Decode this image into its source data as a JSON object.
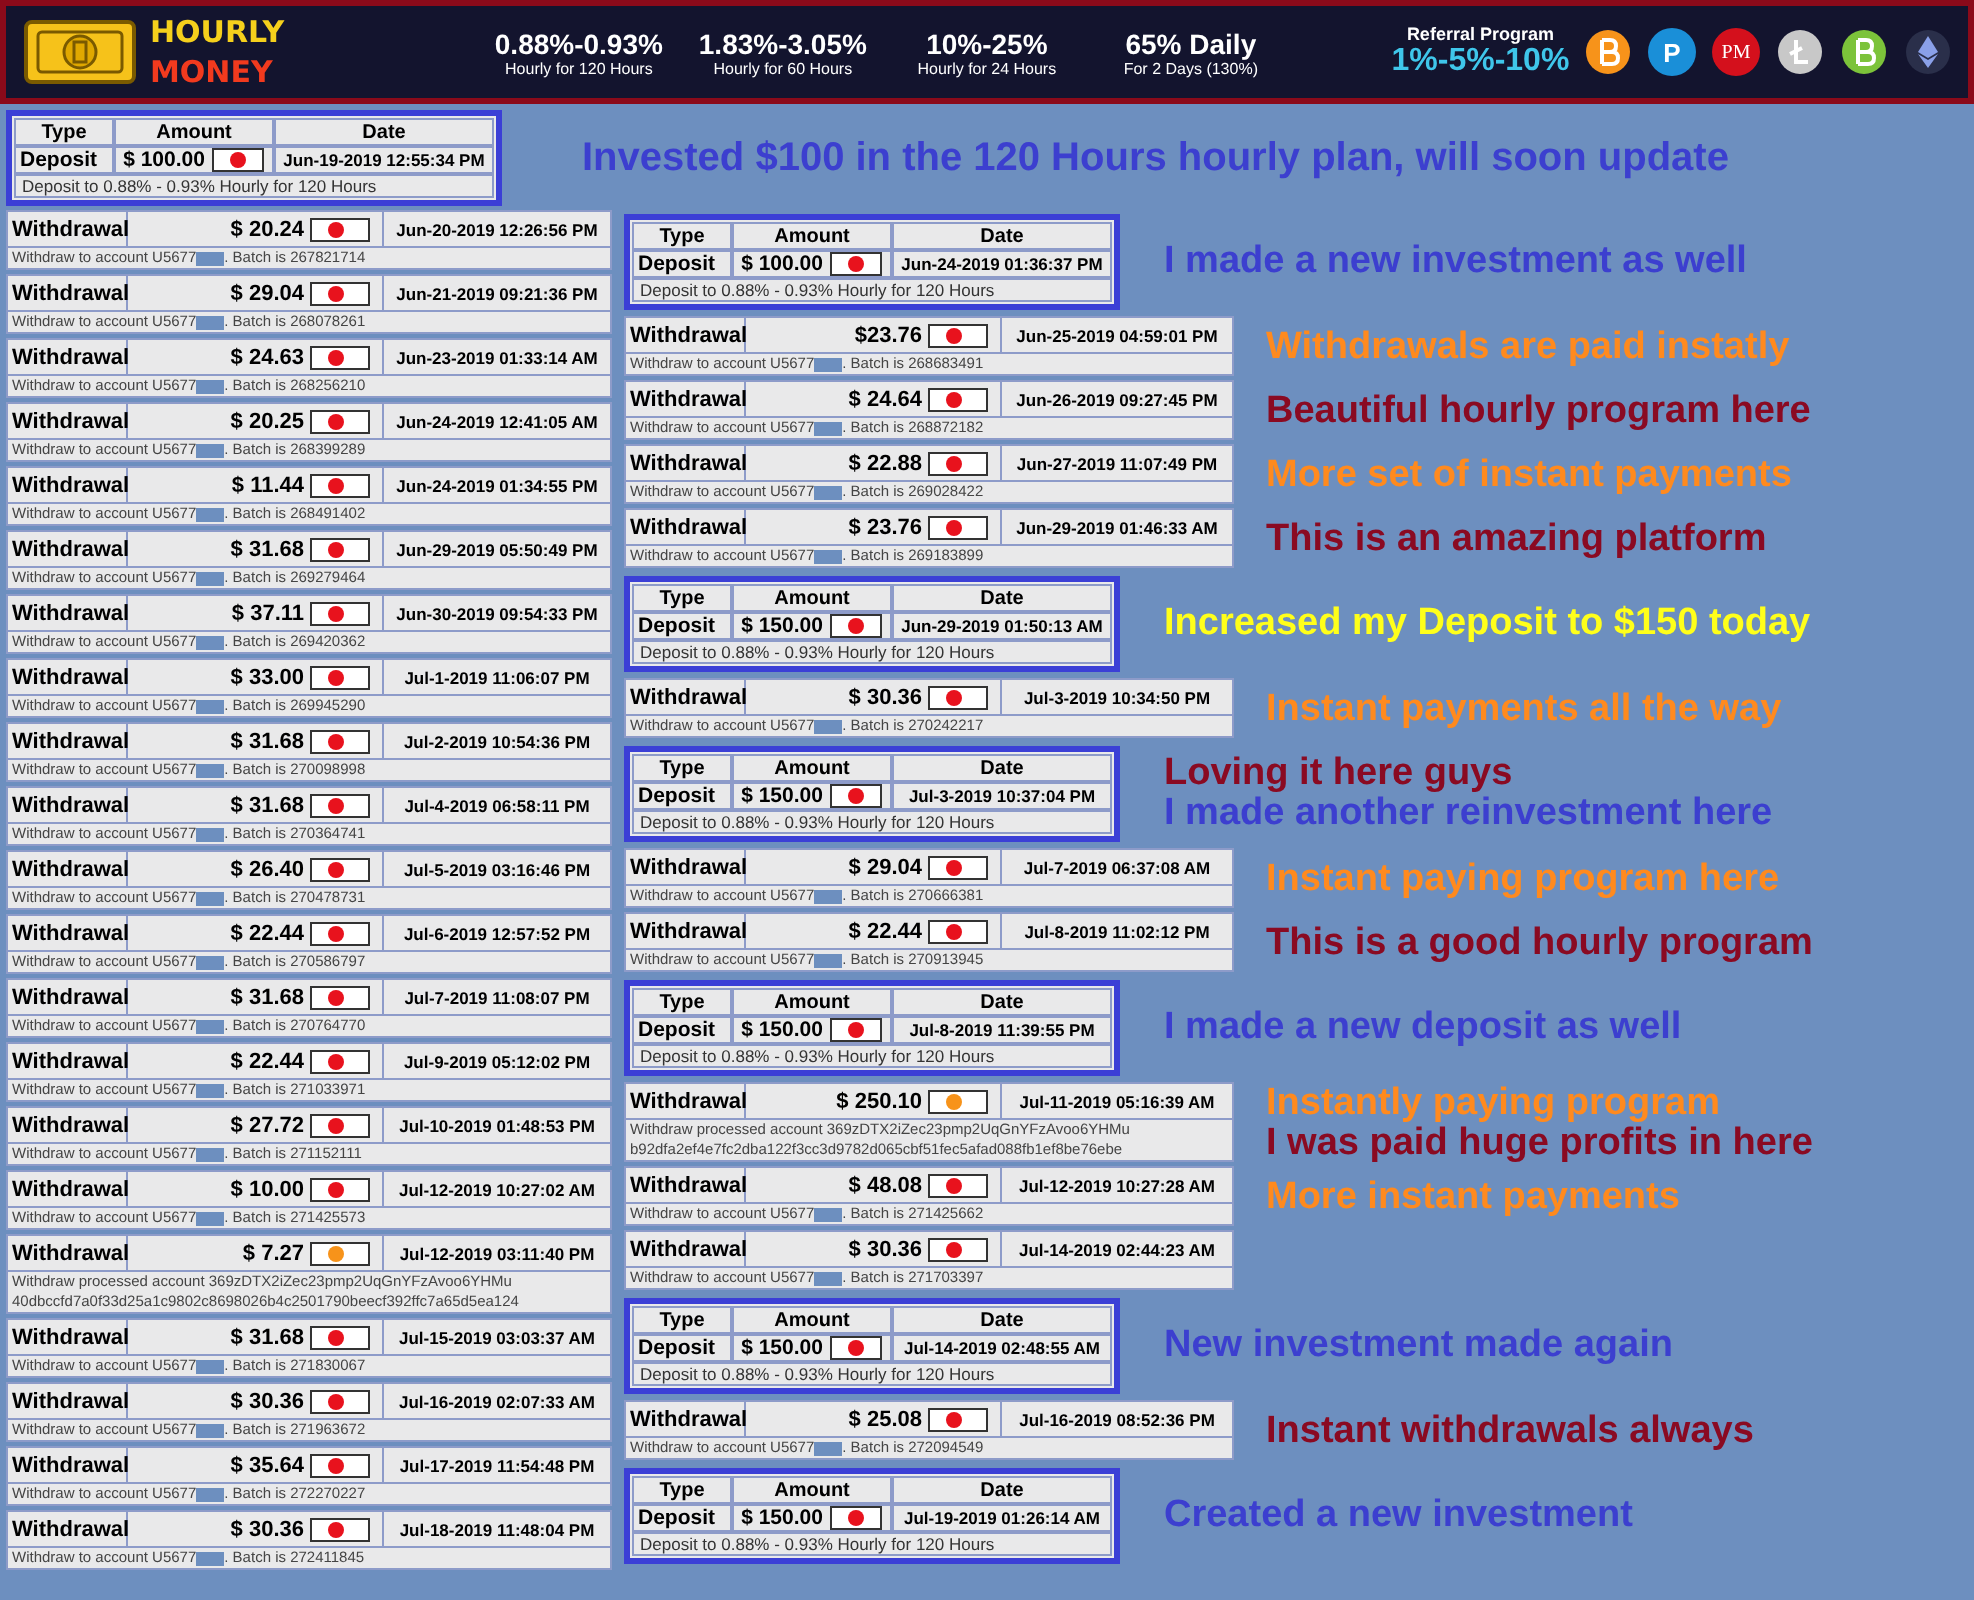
{
  "header": {
    "logo": {
      "line_1": "HOURLY",
      "line_2": "MONEY"
    },
    "plans": [
      {
        "rate": "0.88%-0.93%",
        "term": "Hourly for 120 Hours"
      },
      {
        "rate": "1.83%-3.05%",
        "term": "Hourly for 60 Hours"
      },
      {
        "rate": "10%-25%",
        "term": "Hourly for 24 Hours"
      },
      {
        "rate": "65% Daily",
        "term": "For 2 Days (130%)"
      }
    ],
    "referral": {
      "title": "Referral Program",
      "rates": "1%-5%-10%"
    },
    "coins": [
      {
        "kind": "bitcoin"
      },
      {
        "kind": "p",
        "label": "P"
      },
      {
        "kind": "pm",
        "label": "PM"
      },
      {
        "kind": "litecoin"
      },
      {
        "kind": "bitcoin-cash"
      },
      {
        "kind": "ethereum"
      }
    ]
  },
  "intro": {
    "deposit": {
      "columns": [
        "Type",
        "Amount",
        "Date"
      ],
      "type": "Deposit",
      "amount": "$ 100.00",
      "payment": {
        "kind": "pm"
      },
      "date": "Jun-19-2019 12:55:34 PM",
      "detail": "Deposit to 0.88% - 0.93% Hourly for 120 Hours"
    },
    "caption": {
      "text": "Invested $100 in the 120 Hours hourly plan, will soon update",
      "color": "#3c3fcf"
    }
  },
  "withdrawals": [
    {
      "type": "Withdrawal",
      "amount": "$ 20.24",
      "payment": {
        "kind": "pm"
      },
      "date": "Jun-20-2019 12:26:56 PM",
      "detail": "Withdraw to account U5677",
      "redacted": true,
      "batch": ". Batch is 267821714"
    },
    {
      "type": "Withdrawal",
      "amount": "$ 29.04",
      "payment": {
        "kind": "pm"
      },
      "date": "Jun-21-2019 09:21:36 PM",
      "detail": "Withdraw to account U5677",
      "redacted": true,
      "batch": ". Batch is 268078261"
    },
    {
      "type": "Withdrawal",
      "amount": "$ 24.63",
      "payment": {
        "kind": "pm"
      },
      "date": "Jun-23-2019 01:33:14 AM",
      "detail": "Withdraw to account U5677",
      "redacted": true,
      "batch": ". Batch is 268256210"
    },
    {
      "type": "Withdrawal",
      "amount": "$ 20.25",
      "payment": {
        "kind": "pm"
      },
      "date": "Jun-24-2019 12:41:05 AM",
      "detail": "Withdraw to account U5677",
      "redacted": true,
      "batch": ". Batch is 268399289"
    },
    {
      "type": "Withdrawal",
      "amount": "$ 11.44",
      "payment": {
        "kind": "pm"
      },
      "date": "Jun-24-2019 01:34:55 PM",
      "detail": "Withdraw to account U5677",
      "redacted": true,
      "batch": ". Batch is 268491402"
    },
    {
      "type": "Withdrawal",
      "amount": "$ 31.68",
      "payment": {
        "kind": "pm"
      },
      "date": "Jun-29-2019 05:50:49 PM",
      "detail": "Withdraw to account U5677",
      "redacted": true,
      "batch": ". Batch is 269279464"
    },
    {
      "type": "Withdrawal",
      "amount": "$ 37.11",
      "payment": {
        "kind": "pm"
      },
      "date": "Jun-30-2019 09:54:33 PM",
      "detail": "Withdraw to account U5677",
      "redacted": true,
      "batch": ". Batch is 269420362"
    },
    {
      "type": "Withdrawal",
      "amount": "$ 33.00",
      "payment": {
        "kind": "pm"
      },
      "date": "Jul-1-2019 11:06:07 PM",
      "detail": "Withdraw to account U5677",
      "redacted": true,
      "batch": ". Batch is 269945290"
    },
    {
      "type": "Withdrawal",
      "amount": "$ 31.68",
      "payment": {
        "kind": "pm"
      },
      "date": "Jul-2-2019 10:54:36 PM",
      "detail": "Withdraw to account U5677",
      "redacted": true,
      "batch": ". Batch is 270098998"
    },
    {
      "type": "Withdrawal",
      "amount": "$ 31.68",
      "payment": {
        "kind": "pm"
      },
      "date": "Jul-4-2019 06:58:11 PM",
      "detail": "Withdraw to account U5677",
      "redacted": true,
      "batch": ". Batch is 270364741"
    },
    {
      "type": "Withdrawal",
      "amount": "$ 26.40",
      "payment": {
        "kind": "pm"
      },
      "date": "Jul-5-2019 03:16:46 PM",
      "detail": "Withdraw to account U5677",
      "redacted": true,
      "batch": ". Batch is 270478731"
    },
    {
      "type": "Withdrawal",
      "amount": "$ 22.44",
      "payment": {
        "kind": "pm"
      },
      "date": "Jul-6-2019 12:57:52 PM",
      "detail": "Withdraw to account U5677",
      "redacted": true,
      "batch": ". Batch is 270586797"
    },
    {
      "type": "Withdrawal",
      "amount": "$ 31.68",
      "payment": {
        "kind": "pm"
      },
      "date": "Jul-7-2019 11:08:07 PM",
      "detail": "Withdraw to account U5677",
      "redacted": true,
      "batch": ". Batch is 270764770"
    },
    {
      "type": "Withdrawal",
      "amount": "$ 22.44",
      "payment": {
        "kind": "pm"
      },
      "date": "Jul-9-2019 05:12:02 PM",
      "detail": "Withdraw to account U5677",
      "redacted": true,
      "batch": ". Batch is 271033971"
    },
    {
      "type": "Withdrawal",
      "amount": "$ 27.72",
      "payment": {
        "kind": "pm"
      },
      "date": "Jul-10-2019 01:48:53 PM",
      "detail": "Withdraw to account U5677",
      "redacted": true,
      "batch": ". Batch is 271152111"
    },
    {
      "type": "Withdrawal",
      "amount": "$ 10.00",
      "payment": {
        "kind": "pm"
      },
      "date": "Jul-12-2019 10:27:02 AM",
      "detail": "Withdraw to account U5677",
      "redacted": true,
      "batch": ". Batch is 271425573"
    },
    {
      "type": "Withdrawal",
      "amount": "$ 7.27",
      "payment": {
        "kind": "btc"
      },
      "date": "Jul-12-2019 03:11:40 PM",
      "detail": "Withdraw processed account 369zDTX2iZec23pmp2UqGnYFzAvoo6YHMu",
      "redacted": false,
      "batch": "40dbccfd7a0f33d25a1c9802c8698026b4c2501790beecf392ffc7a65d5ea124"
    },
    {
      "type": "Withdrawal",
      "amount": "$ 31.68",
      "payment": {
        "kind": "pm"
      },
      "date": "Jul-15-2019 03:03:37 AM",
      "detail": "Withdraw to account U5677",
      "redacted": true,
      "batch": ". Batch is 271830067"
    },
    {
      "type": "Withdrawal",
      "amount": "$ 30.36",
      "payment": {
        "kind": "pm"
      },
      "date": "Jul-16-2019 02:07:33 AM",
      "detail": "Withdraw to account U5677",
      "redacted": true,
      "batch": ". Batch is 271963672"
    },
    {
      "type": "Withdrawal",
      "amount": "$ 35.64",
      "payment": {
        "kind": "pm"
      },
      "date": "Jul-17-2019 11:54:48 PM",
      "detail": "Withdraw to account U5677",
      "redacted": true,
      "batch": ". Batch is 272270227"
    },
    {
      "type": "Withdrawal",
      "amount": "$ 30.36",
      "payment": {
        "kind": "pm"
      },
      "date": "Jul-18-2019 11:48:04 PM",
      "detail": "Withdraw to account U5677",
      "redacted": true,
      "batch": ". Batch is 272411845"
    }
  ],
  "feed": [
    {
      "kind": "deposit",
      "columns": [
        "Type",
        "Amount",
        "Date"
      ],
      "type": "Deposit",
      "amount": "$ 100.00",
      "payment": {
        "kind": "pm"
      },
      "date": "Jun-24-2019 01:36:37 PM",
      "detail": "Deposit to 0.88% - 0.93% Hourly for 120 Hours",
      "captions": [
        {
          "text": "I made a new investment as well",
          "color": "#3c3fcf"
        }
      ]
    },
    {
      "kind": "withdrawal",
      "type": "Withdrawal",
      "amount": "$23.76",
      "payment": {
        "kind": "pm"
      },
      "date": "Jun-25-2019 04:59:01 PM",
      "detail": "Withdraw to account U5677",
      "redacted": true,
      "batch": ". Batch is 268683491",
      "captions": [
        {
          "text": "Withdrawals are paid instatly",
          "color": "#ff8a1e"
        }
      ]
    },
    {
      "kind": "withdrawal",
      "type": "Withdrawal",
      "amount": "$ 24.64",
      "payment": {
        "kind": "pm"
      },
      "date": "Jun-26-2019 09:27:45 PM",
      "detail": "Withdraw to account U5677",
      "redacted": true,
      "batch": ". Batch is 268872182",
      "captions": [
        {
          "text": "Beautiful hourly program here",
          "color": "#8a0a22"
        }
      ]
    },
    {
      "kind": "withdrawal",
      "type": "Withdrawal",
      "amount": "$ 22.88",
      "payment": {
        "kind": "pm"
      },
      "date": "Jun-27-2019 11:07:49 PM",
      "detail": "Withdraw to account U5677",
      "redacted": true,
      "batch": ". Batch is 269028422",
      "captions": [
        {
          "text": "More set of instant payments",
          "color": "#ff8a1e"
        }
      ]
    },
    {
      "kind": "withdrawal",
      "type": "Withdrawal",
      "amount": "$ 23.76",
      "payment": {
        "kind": "pm"
      },
      "date": "Jun-29-2019 01:46:33 AM",
      "detail": "Withdraw to account U5677",
      "redacted": true,
      "batch": ". Batch is 269183899",
      "captions": [
        {
          "text": "This is an amazing platform",
          "color": "#8a0a22"
        }
      ]
    },
    {
      "kind": "deposit",
      "columns": [
        "Type",
        "Amount",
        "Date"
      ],
      "type": "Deposit",
      "amount": "$ 150.00",
      "payment": {
        "kind": "pm"
      },
      "date": "Jun-29-2019 01:50:13 AM",
      "detail": "Deposit to 0.88% - 0.93% Hourly for 120 Hours",
      "captions": [
        {
          "text": "Increased my Deposit to $150 today",
          "color": "#ffff1a"
        }
      ]
    },
    {
      "kind": "withdrawal",
      "type": "Withdrawal",
      "amount": "$ 30.36",
      "payment": {
        "kind": "pm"
      },
      "date": "Jul-3-2019 10:34:50 PM",
      "detail": "Withdraw to account U5677",
      "redacted": true,
      "batch": ". Batch is 270242217",
      "captions": [
        {
          "text": "Instant payments all the way",
          "color": "#ff8a1e"
        }
      ]
    },
    {
      "kind": "deposit",
      "columns": [
        "Type",
        "Amount",
        "Date"
      ],
      "type": "Deposit",
      "amount": "$ 150.00",
      "payment": {
        "kind": "pm"
      },
      "date": "Jul-3-2019 10:37:04 PM",
      "detail": "Deposit to 0.88% - 0.93% Hourly for 120 Hours",
      "captions": [
        {
          "text": "Loving it here guys",
          "color": "#8a0a22"
        },
        {
          "text": "I made another reinvestment here",
          "color": "#3c3fcf"
        }
      ]
    },
    {
      "kind": "withdrawal",
      "type": "Withdrawal",
      "amount": "$ 29.04",
      "payment": {
        "kind": "pm"
      },
      "date": "Jul-7-2019 06:37:08 AM",
      "detail": "Withdraw to account U5677",
      "redacted": true,
      "batch": ". Batch is 270666381",
      "captions": [
        {
          "text": "Instant paying program here",
          "color": "#ff8a1e"
        }
      ]
    },
    {
      "kind": "withdrawal",
      "type": "Withdrawal",
      "amount": "$ 22.44",
      "payment": {
        "kind": "pm"
      },
      "date": "Jul-8-2019 11:02:12 PM",
      "detail": "Withdraw to account U5677",
      "redacted": true,
      "batch": ". Batch is 270913945",
      "captions": [
        {
          "text": "This is a good hourly program",
          "color": "#8a0a22"
        }
      ]
    },
    {
      "kind": "deposit",
      "columns": [
        "Type",
        "Amount",
        "Date"
      ],
      "type": "Deposit",
      "amount": "$ 150.00",
      "payment": {
        "kind": "pm"
      },
      "date": "Jul-8-2019 11:39:55 PM",
      "detail": "Deposit to 0.88% - 0.93% Hourly for 120 Hours",
      "captions": [
        {
          "text": "I made a new deposit as well",
          "color": "#3c3fcf"
        }
      ]
    },
    {
      "kind": "withdrawal",
      "type": "Withdrawal",
      "amount": "$ 250.10",
      "payment": {
        "kind": "btc"
      },
      "date": "Jul-11-2019 05:16:39 AM",
      "detail": "Withdraw processed account 369zDTX2iZec23pmp2UqGnYFzAvoo6YHMu",
      "redacted": false,
      "batch": "b92dfa2ef4e7fc2dba122f3cc3d9782d065cbf51fec5afad088fb1ef8be76ebe",
      "captions": [
        {
          "text": "Instantly paying program",
          "color": "#ff8a1e"
        },
        {
          "text": "I was paid huge profits in here",
          "color": "#8a0a22"
        }
      ]
    },
    {
      "kind": "withdrawal",
      "type": "Withdrawal",
      "amount": "$ 48.08",
      "payment": {
        "kind": "pm"
      },
      "date": "Jul-12-2019 10:27:28 AM",
      "detail": "Withdraw to account U5677",
      "redacted": true,
      "batch": ". Batch is 271425662",
      "captions": [
        {
          "text": "More instant payments",
          "color": "#ff8a1e"
        }
      ]
    },
    {
      "kind": "withdrawal",
      "type": "Withdrawal",
      "amount": "$ 30.36",
      "payment": {
        "kind": "pm"
      },
      "date": "Jul-14-2019 02:44:23 AM",
      "detail": "Withdraw to account U5677",
      "redacted": true,
      "batch": ". Batch is 271703397"
    },
    {
      "kind": "deposit",
      "columns": [
        "Type",
        "Amount",
        "Date"
      ],
      "type": "Deposit",
      "amount": "$ 150.00",
      "payment": {
        "kind": "pm"
      },
      "date": "Jul-14-2019 02:48:55 AM",
      "detail": "Deposit to 0.88% - 0.93% Hourly for 120 Hours",
      "captions": [
        {
          "text": "New investment made again",
          "color": "#3c3fcf"
        }
      ]
    },
    {
      "kind": "withdrawal",
      "type": "Withdrawal",
      "amount": "$ 25.08",
      "payment": {
        "kind": "pm"
      },
      "date": "Jul-16-2019 08:52:36 PM",
      "detail": "Withdraw to account U5677",
      "redacted": true,
      "batch": ". Batch is 272094549",
      "captions": [
        {
          "text": "Instant withdrawals always",
          "color": "#8a0a22"
        }
      ]
    },
    {
      "kind": "deposit",
      "columns": [
        "Type",
        "Amount",
        "Date"
      ],
      "type": "Deposit",
      "amount": "$ 150.00",
      "payment": {
        "kind": "pm"
      },
      "date": "Jul-19-2019 01:26:14 AM",
      "detail": "Deposit to 0.88% - 0.93% Hourly for 120 Hours",
      "captions": [
        {
          "text": "Created a new investment",
          "color": "#3c3fcf"
        }
      ]
    }
  ]
}
